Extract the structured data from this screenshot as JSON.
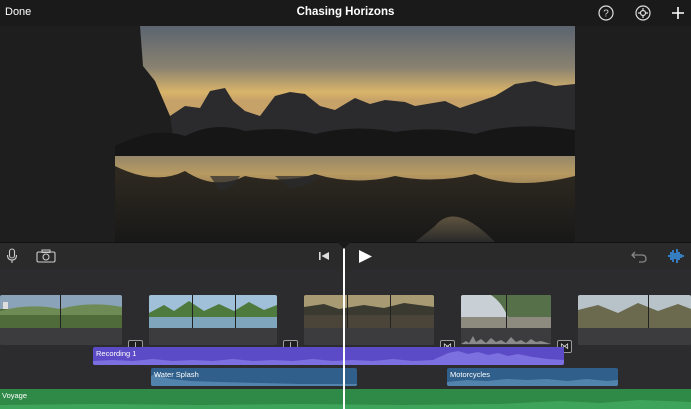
{
  "header": {
    "done_label": "Done",
    "title": "Chasing Horizons"
  },
  "icons": {
    "help": "help-circle-icon",
    "settings": "settings-icon",
    "add": "plus-icon",
    "mic": "microphone-icon",
    "camera": "camera-icon",
    "skip_back": "skip-to-start-icon",
    "play": "play-icon",
    "undo": "undo-icon",
    "audio": "audio-waveform-icon"
  },
  "timeline": {
    "audio_clips": {
      "recording": "Recording 1",
      "splash": "Water Splash",
      "motorcycles": "Motorcycles",
      "music": "Voyage"
    }
  },
  "colors": {
    "recording": "#5b4bc6",
    "sound_effect": "#2f5f8a",
    "music": "#2f8a48",
    "accent": "#3aa0ff"
  }
}
